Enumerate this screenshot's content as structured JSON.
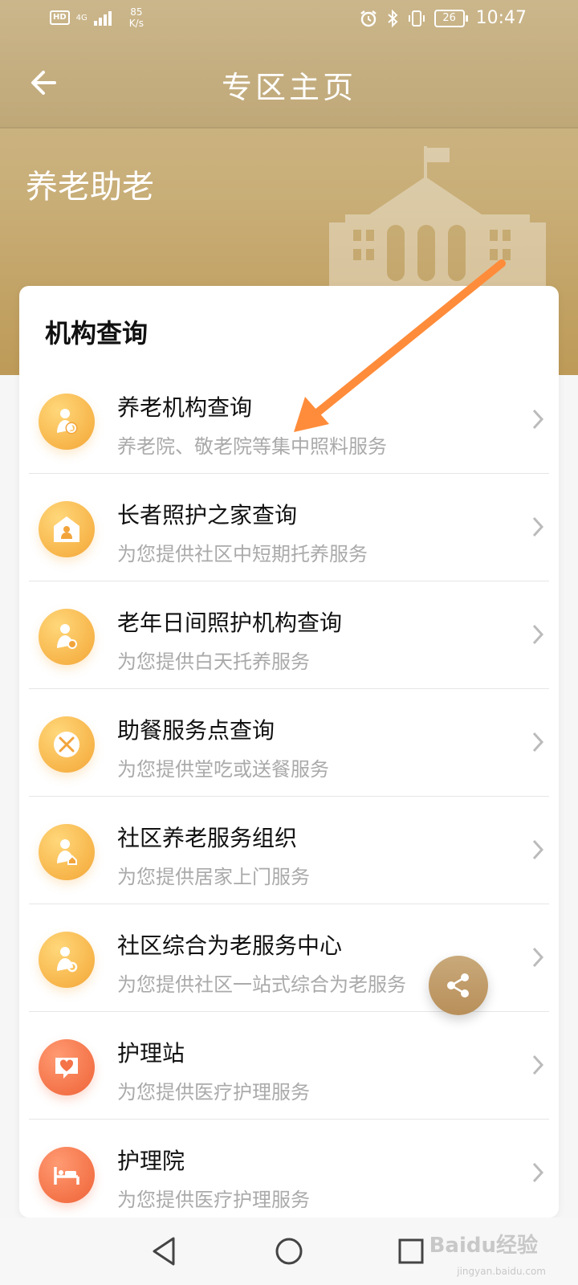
{
  "status_bar": {
    "hd": "HD",
    "network": "4G",
    "speed_value": "85",
    "speed_unit": "K/s",
    "battery": "26",
    "time": "10:47"
  },
  "header": {
    "title": "专区主页",
    "back_icon": "arrow-left-icon"
  },
  "zone": {
    "name": "养老助老"
  },
  "card": {
    "title": "机构查询",
    "items": [
      {
        "title": "养老机构查询",
        "subtitle": "养老院、敬老院等集中照料服务",
        "icon": "elder-search-icon",
        "color": "gold"
      },
      {
        "title": "长者照护之家查询",
        "subtitle": "为您提供社区中短期托养服务",
        "icon": "home-care-icon",
        "color": "gold"
      },
      {
        "title": "老年日间照护机构查询",
        "subtitle": "为您提供白天托养服务",
        "icon": "day-care-icon",
        "color": "gold"
      },
      {
        "title": "助餐服务点查询",
        "subtitle": "为您提供堂吃或送餐服务",
        "icon": "meal-icon",
        "color": "gold"
      },
      {
        "title": "社区养老服务组织",
        "subtitle": "为您提供居家上门服务",
        "icon": "community-service-icon",
        "color": "gold"
      },
      {
        "title": "社区综合为老服务中心",
        "subtitle": "为您提供社区一站式综合为老服务",
        "icon": "service-center-icon",
        "color": "gold"
      },
      {
        "title": "护理站",
        "subtitle": "为您提供医疗护理服务",
        "icon": "nursing-station-icon",
        "color": "red"
      },
      {
        "title": "护理院",
        "subtitle": "为您提供医疗护理服务",
        "icon": "nursing-home-icon",
        "color": "red"
      }
    ]
  },
  "share_icon": "share-icon",
  "colors": {
    "hero": "#c8ad76",
    "gold_icon": "#f7b54a",
    "red_icon": "#f47348",
    "arrow": "#ff8c3a"
  },
  "watermark": {
    "brand": "Baidu经验",
    "url": "jingyan.baidu.com"
  }
}
